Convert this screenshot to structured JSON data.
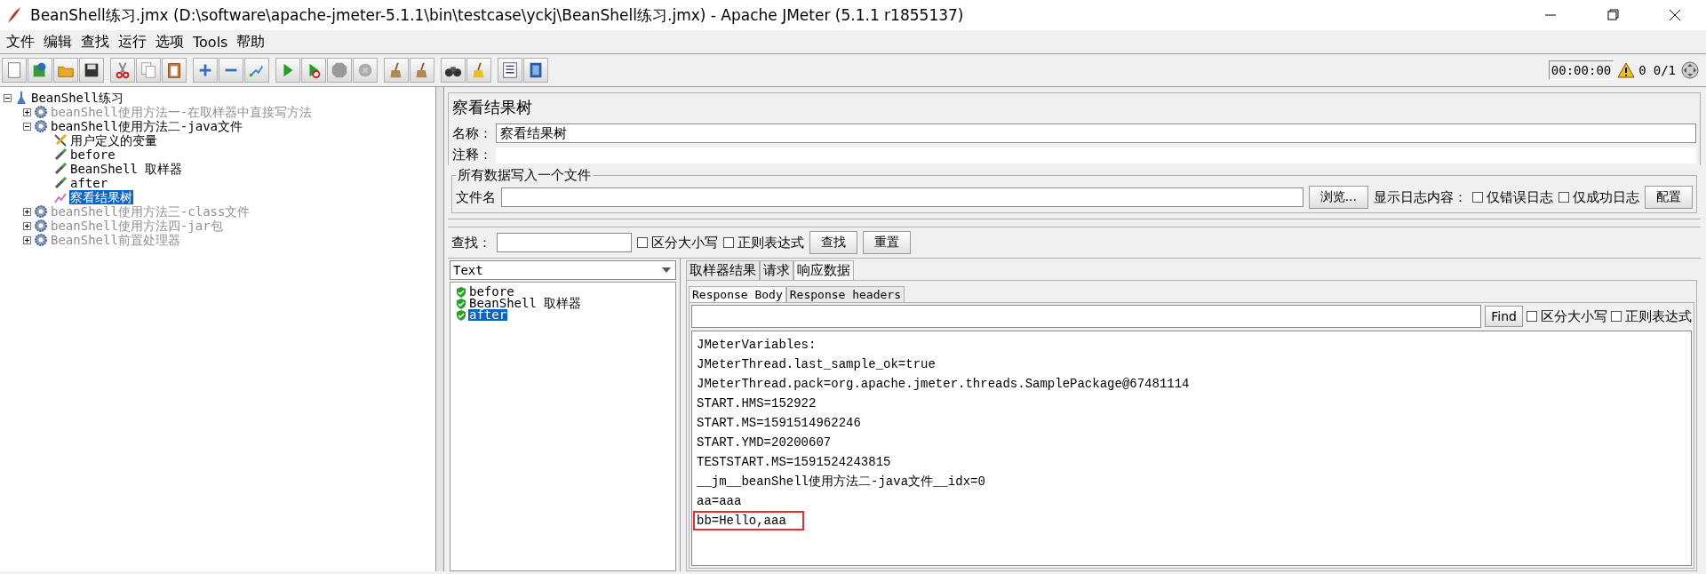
{
  "window": {
    "title": "BeanShell练习.jmx (D:\\software\\apache-jmeter-5.1.1\\bin\\testcase\\yckj\\BeanShell练习.jmx) - Apache JMeter (5.1.1 r1855137)"
  },
  "menu": [
    "文件",
    "编辑",
    "查找",
    "运行",
    "选项",
    "Tools",
    "帮助"
  ],
  "status": {
    "timer": "00:00:00",
    "warnings": "0",
    "threads": "0/1"
  },
  "tree": {
    "label": "BeanShell练习",
    "kind": "plan",
    "expanded": true,
    "disabled": false,
    "selected": false,
    "children": [
      {
        "label": "beanShell使用方法一-在取样器中直接写方法",
        "kind": "group",
        "expanded": false,
        "disabled": true,
        "selected": false
      },
      {
        "label": "beanShell使用方法二-java文件",
        "kind": "group",
        "expanded": true,
        "disabled": false,
        "selected": false,
        "children": [
          {
            "label": "用户定义的变量",
            "kind": "config",
            "disabled": false,
            "selected": false
          },
          {
            "label": "before",
            "kind": "sampler",
            "disabled": false,
            "selected": false
          },
          {
            "label": "BeanShell 取样器",
            "kind": "sampler",
            "disabled": false,
            "selected": false
          },
          {
            "label": "after",
            "kind": "sampler",
            "disabled": false,
            "selected": false
          },
          {
            "label": "察看结果树",
            "kind": "listener",
            "disabled": false,
            "selected": true
          }
        ]
      },
      {
        "label": "beanShell使用方法三-class文件",
        "kind": "group",
        "expanded": false,
        "disabled": true,
        "selected": false
      },
      {
        "label": "beanShell使用方法四-jar包",
        "kind": "group",
        "expanded": false,
        "disabled": true,
        "selected": false
      },
      {
        "label": "BeanShell前置处理器",
        "kind": "group",
        "expanded": false,
        "disabled": true,
        "selected": false
      }
    ]
  },
  "panel": {
    "title": "察看结果树",
    "name_label": "名称：",
    "name_value": "察看结果树",
    "comment_label": "注释：",
    "file_group": {
      "title": "所有数据写入一个文件",
      "file_label": "文件名",
      "browse": "浏览...",
      "log_label": "显示日志内容：",
      "options": [
        {
          "label": "仅错误日志",
          "checked": false
        },
        {
          "label": "仅成功日志",
          "checked": false
        }
      ],
      "config": "配置"
    },
    "search": {
      "label": "查找：",
      "options": [
        {
          "label": "区分大小写",
          "checked": false
        },
        {
          "label": "正则表达式",
          "checked": false
        }
      ],
      "buttons": [
        "查找",
        "重置"
      ]
    }
  },
  "renderer": "Text",
  "results": [
    {
      "label": "before",
      "selected": false
    },
    {
      "label": "BeanShell 取样器",
      "selected": false
    },
    {
      "label": "after",
      "selected": true
    }
  ],
  "tabs": [
    {
      "label": "取样器结果",
      "selected": false
    },
    {
      "label": "请求",
      "selected": false
    },
    {
      "label": "响应数据",
      "selected": true
    }
  ],
  "subtabs": [
    {
      "label": "Response Body",
      "selected": true
    },
    {
      "label": "Response headers",
      "selected": false
    }
  ],
  "find": {
    "button": "Find",
    "options": [
      {
        "label": "区分大小写",
        "checked": false
      },
      {
        "label": "正则表达式",
        "checked": false
      }
    ]
  },
  "response_lines": [
    {
      "text": "JMeterVariables:",
      "highlighted": false
    },
    {
      "text": "JMeterThread.last_sample_ok=true",
      "highlighted": false
    },
    {
      "text": "JMeterThread.pack=org.apache.jmeter.threads.SamplePackage@67481114",
      "highlighted": false
    },
    {
      "text": "START.HMS=152922",
      "highlighted": false
    },
    {
      "text": "START.MS=1591514962246",
      "highlighted": false
    },
    {
      "text": "START.YMD=20200607",
      "highlighted": false
    },
    {
      "text": "TESTSTART.MS=1591524243815",
      "highlighted": false
    },
    {
      "text": "__jm__beanShell使用方法二-java文件__idx=0",
      "highlighted": false
    },
    {
      "text": "aa=aaa",
      "highlighted": false
    },
    {
      "text": "bb=Hello,aaa",
      "highlighted": true
    }
  ]
}
